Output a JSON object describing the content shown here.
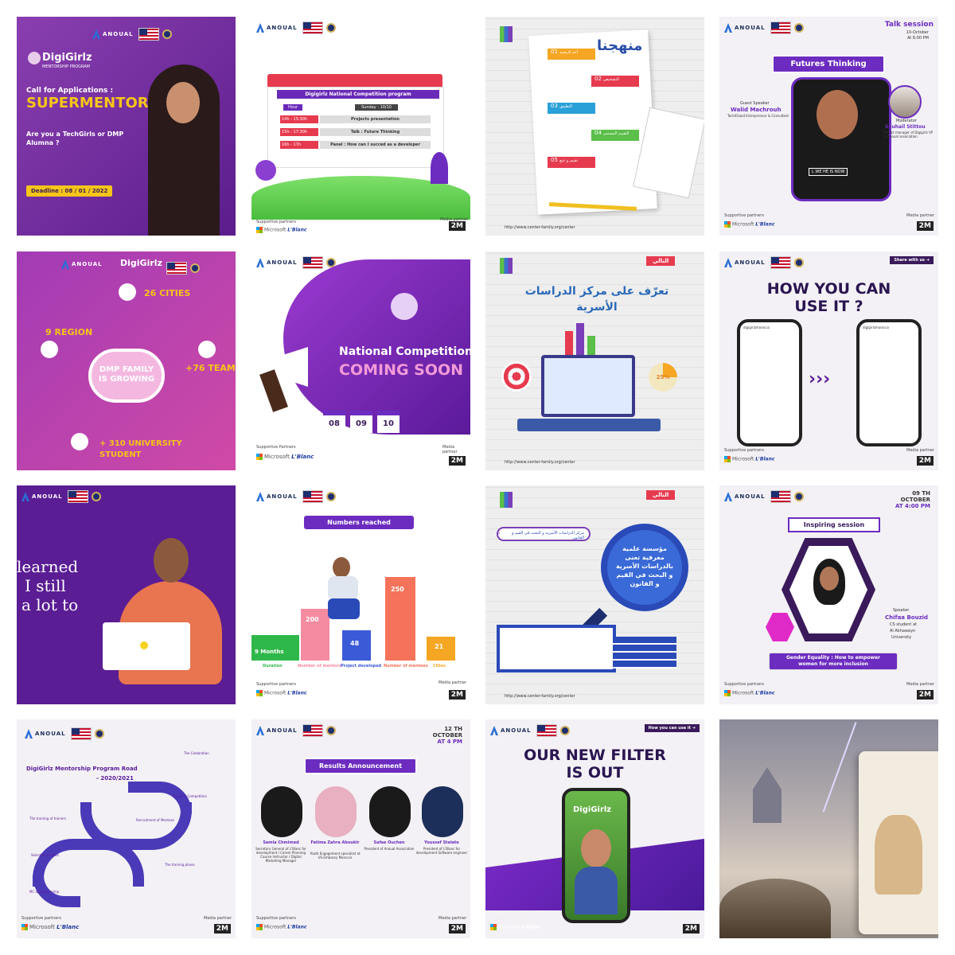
{
  "tiles": {
    "t1": {
      "brand": "ANOUAL",
      "logo": "DigiGirlz",
      "logo_sub": "MENTORSHIP PROGRAM",
      "line1": "Call for Applications :",
      "line2": "SUPERMENTORS",
      "question": "Are you a TechGirls or DMP Alumna ?",
      "deadline": "Deadline : 08 / 01 / 2022",
      "colors": {
        "bg": "#8a3fb0",
        "accent": "#f5c518"
      }
    },
    "t2": {
      "brand": "ANOUAL",
      "title": "Digigirlz National Competition program",
      "day_col": "Hour",
      "day": "Sunday : 10/10",
      "rows": [
        {
          "time": "14h - 15:30h",
          "event": "Projects presentation"
        },
        {
          "time": "15h - 17:30h",
          "event": "Talk : Future Thinking"
        },
        {
          "time": "16h - 17h",
          "event": "Panel : How can I succed as a developer"
        }
      ],
      "partners_label": "Supportive partners",
      "media_label": "Media partner",
      "ms": "Microsoft",
      "lblanc": "L'Blanc",
      "twom": "2M"
    },
    "t3": {
      "title": "منهجنا",
      "steps": [
        {
          "num": "01",
          "label": "أخذ الرصيد"
        },
        {
          "num": "02",
          "label": "التشخيص"
        },
        {
          "num": "03",
          "label": "التطبيق"
        },
        {
          "num": "04",
          "label": "التقييم المستمر"
        },
        {
          "num": "05",
          "label": "تقييم و تتبع"
        }
      ],
      "footer": "http://www.center-family.org/center"
    },
    "t4": {
      "brand": "ANOUAL",
      "talk": "Talk session",
      "date": "10-October",
      "time": "At 6:00 PM",
      "title": "Futures Thinking",
      "guest_role": "Guest Speaker",
      "guest": "Walid Machrouh",
      "guest_desc": "Tech4Good Entrepreneur & Consultant",
      "mod_role": "Moderator",
      "mod": "Souhail Stittou",
      "mod_desc": "Project manager of Digigirlz VP of Anoual association",
      "shirt": "L WE HE IS NOW",
      "partners_label": "Supportive partners",
      "media_label": "Media partner",
      "ms": "Microsoft",
      "lblanc": "L'Blanc",
      "twom": "2M"
    },
    "t5": {
      "brand": "ANOUAL",
      "logo": "DigiGirlz",
      "cities": "26 CITIES",
      "region": "9 REGION",
      "team": "+76 TEAM",
      "center1": "DMP FAMILY",
      "center2": "IS GROWING",
      "students": "+ 310 UNIVERSITY STUDENT"
    },
    "t6": {
      "brand": "ANOUAL",
      "line1": "National Competition",
      "line2": "COMING SOON",
      "dates": [
        "08",
        "09",
        "10"
      ],
      "partners_label": "Supportive Partners",
      "media_label": "Media partner",
      "ms": "Microsoft",
      "lblanc": "L'Blanc",
      "twom": "2M"
    },
    "t7": {
      "next": "التالي",
      "title": "تعرّف على مركز الدراسات الأسرية",
      "pct": "25%",
      "footer": "http://www.center-family.org/center"
    },
    "t8": {
      "brand": "ANOUAL",
      "share": "Share with us",
      "title1": "HOW YOU CAN",
      "title2": "USE IT ?",
      "handle": "digigirlzmorocco",
      "partners_label": "Supportive partners",
      "media_label": "Media partner",
      "ms": "Microsoft",
      "lblanc": "L'Blanc",
      "twom": "2M"
    },
    "t9": {
      "brand": "ANOUAL",
      "line1": "learned",
      "line2": "I still",
      "line3": "a lot to"
    },
    "t10": {
      "brand": "ANOUAL",
      "title": "Numbers reached",
      "values": [
        "9 Months",
        "200",
        "48",
        "250",
        "21"
      ],
      "labels": [
        "Duration",
        "Number of mentors",
        "Project developed",
        "Number of mentees",
        "Cities"
      ],
      "partners_label": "Supportive partners",
      "media_label": "Media partner",
      "ms": "Microsoft",
      "lblanc": "L'Blanc",
      "twom": "2M"
    },
    "t11": {
      "next": "التالي",
      "search": "مركز الدراسات الأسرية و البحث في القيم و القانون",
      "lens1": "مؤسسة علمية",
      "lens2": "معرفية تعنى",
      "lens3": "بالدراسات الأسرية",
      "lens4": "و البحث في القيم",
      "lens5": "و القانون",
      "footer": "http://www.center-family.org/center"
    },
    "t12": {
      "brand": "ANOUAL",
      "date_day": "09 TH",
      "date_month": "OCTOBER",
      "date_time": "AT 4:00 PM",
      "title": "Inspiring session",
      "speaker_role": "Speaker",
      "speaker": "Chifaa Bouzid",
      "speaker_desc1": "CS student at",
      "speaker_desc2": "Al Akhawayn",
      "speaker_desc3": "University",
      "topic1": "Gender Equality : How to empower",
      "topic2": "women for more inclusion",
      "partners_label": "Supportive partners",
      "media_label": "Media partner",
      "ms": "Microsoft",
      "lblanc": "L'Blanc",
      "twom": "2M"
    },
    "t13": {
      "brand": "ANOUAL",
      "title1": "DigiGirlz Mentorship Program Road",
      "title2": "- 2020/2021",
      "steps": [
        "The Celebration",
        "Regional Competition",
        "The training of trainers",
        "Recruitment of Mentees",
        "Selection process",
        "The training phase",
        "MC apprenticeship"
      ],
      "partners_label": "Supportive partners",
      "media_label": "Media partner",
      "ms": "Microsoft",
      "lblanc": "L'Blanc",
      "twom": "2M"
    },
    "t14": {
      "brand": "ANOUAL",
      "date_day": "12 TH",
      "date_month": "OCTOBER",
      "date_time": "AT 4 PM",
      "title": "Results Announcement",
      "people": [
        {
          "name": "Samia Chmimed",
          "desc": "Secretary General of L'Blanc for development / Career Planning Course Instructor / Digital Marketing Manager"
        },
        {
          "name": "Fatima Zahra Aboukir",
          "desc": "Youth Engagement specialist at US Embassy Morocco"
        },
        {
          "name": "Safae Ouchen",
          "desc": "President of Anoual Association"
        },
        {
          "name": "Youssef Stelate",
          "desc": "President of L'Blanc for development Software engineer"
        }
      ],
      "partners_label": "Supportive partners",
      "media_label": "Media partner",
      "ms": "Microsoft",
      "lblanc": "L'Blanc",
      "twom": "2M"
    },
    "t15": {
      "brand": "ANOUAL",
      "how": "How you can use it",
      "title1": "OUR NEW FILTER",
      "title2": "IS OUT",
      "logo": "DigiGirlz",
      "partners_label": "Supportive partners",
      "media_label": "Media partner",
      "ms": "Microsoft",
      "lblanc": "L'Blanc",
      "twom": "2M"
    },
    "t16": {}
  }
}
